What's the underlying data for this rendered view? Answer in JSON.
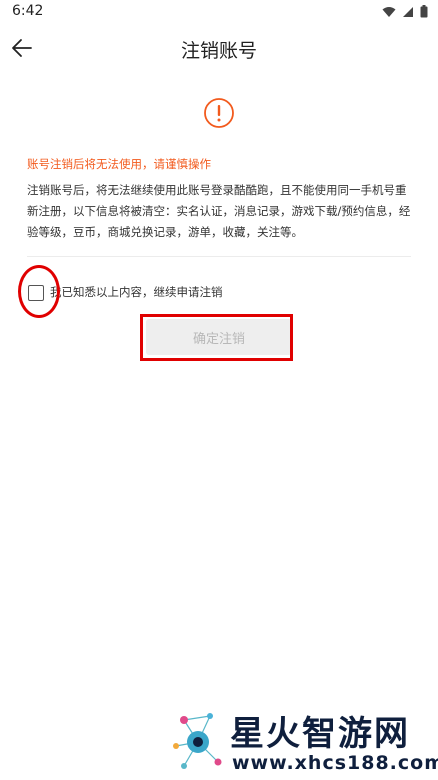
{
  "status_bar": {
    "time": "6:42"
  },
  "header": {
    "title": "注销账号",
    "back_icon": "arrow-left-icon"
  },
  "notice": {
    "icon": "exclamation-circle-icon",
    "warning": "账号注销后将无法使用，请谨慎操作",
    "description": "注销账号后，将无法继续使用此账号登录酷酷跑，且不能使用同一手机号重新注册，以下信息将被清空：实名认证，消息记录，游戏下载/预约信息，经验等级，豆币，商城兑换记录，游单，收藏，关注等。"
  },
  "agreement": {
    "checked": false,
    "label": "我已知悉以上内容，继续申请注销"
  },
  "confirm": {
    "label": "确定注销"
  },
  "watermark": {
    "name": "星火智游网",
    "url": "www.xhcs188.com"
  },
  "colors": {
    "accent": "#f25a1d",
    "highlight": "#e00000",
    "button_bg": "#eeeeee",
    "button_text": "#b8b8b8"
  }
}
